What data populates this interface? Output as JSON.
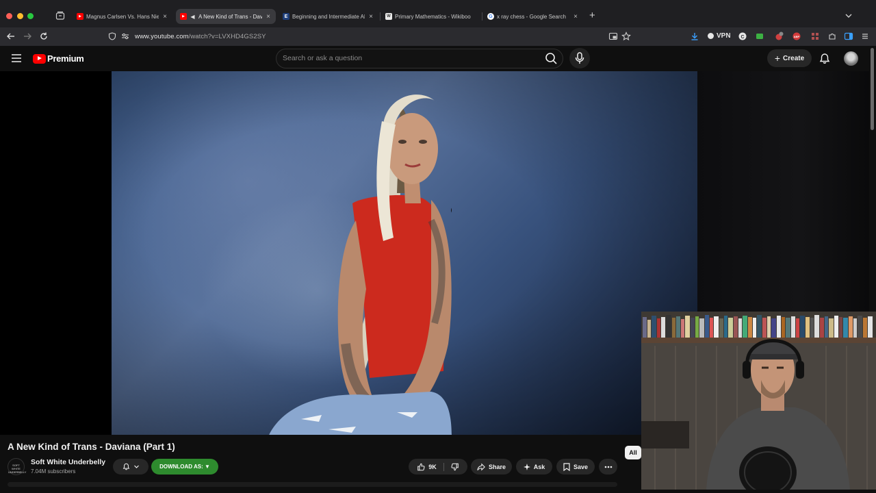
{
  "browser": {
    "tabs": [
      {
        "title": "Magnus Carlsen Vs. Hans Niem",
        "favicon": "youtube-icon",
        "active": false
      },
      {
        "title": "A New Kind of Trans - Davia",
        "favicon": "youtube-icon",
        "active": true
      },
      {
        "title": "Beginning and Intermediate Alg",
        "favicon": "letter-e-icon",
        "active": false
      },
      {
        "title": "Primary Mathematics - Wikiboo",
        "favicon": "wikibooks-icon",
        "active": false
      },
      {
        "title": "x ray chess - Google Search",
        "favicon": "google-icon",
        "active": false
      }
    ],
    "url_host": "www.youtube.com",
    "url_path": "/watch?v=LVXHD4GS2SY",
    "vpn_label": "VPN"
  },
  "youtube": {
    "brand": "Premium",
    "search_placeholder": "Search or ask a question",
    "create_label": "Create"
  },
  "video": {
    "title": "A New Kind of Trans - Daviana (Part 1)",
    "channel_name": "Soft White Underbelly",
    "channel_avatar_text": "SOFT WHITE UNDERBELLY",
    "subscribers": "7.04M subscribers",
    "download_label": "DOWNLOAD AS: ▼",
    "likes": "9K",
    "share_label": "Share",
    "ask_label": "Ask",
    "save_label": "Save"
  },
  "chips": {
    "all": "All"
  },
  "colors": {
    "background": "#0f0f0f",
    "youtube_red": "#ff0000",
    "download_green": "#2e8b2e",
    "pill": "#272727"
  }
}
